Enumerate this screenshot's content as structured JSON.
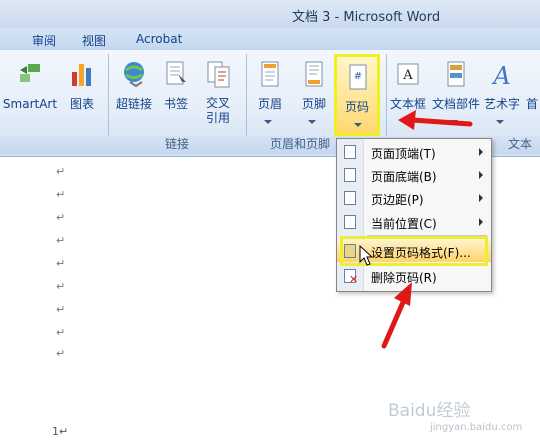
{
  "window": {
    "title": "文档 3 - Microsoft Word"
  },
  "tabs": [
    "审阅",
    "视图",
    "Acrobat"
  ],
  "ribbon": {
    "buttons": [
      {
        "label": "SmartArt"
      },
      {
        "label": "图表"
      },
      {
        "label": "超链接"
      },
      {
        "label": "书签"
      },
      {
        "label": "交叉\n引用"
      },
      {
        "label": "页眉"
      },
      {
        "label": "页脚"
      },
      {
        "label": "页码"
      },
      {
        "label": "文本框"
      },
      {
        "label": "文档部件"
      },
      {
        "label": "艺术字"
      },
      {
        "label": "首"
      }
    ],
    "groups": [
      "链接",
      "页眉和页脚",
      "文本"
    ]
  },
  "menu": {
    "items": [
      {
        "label": "页面顶端(T)",
        "has_submenu": true
      },
      {
        "label": "页面底端(B)",
        "has_submenu": true
      },
      {
        "label": "页边距(P)",
        "has_submenu": true
      },
      {
        "label": "当前位置(C)",
        "has_submenu": true
      },
      {
        "label": "设置页码格式(F)...",
        "has_submenu": false,
        "active": true
      },
      {
        "label": "删除页码(R)",
        "has_submenu": false
      }
    ]
  },
  "doc": {
    "paragraph_mark": "↵",
    "page_number_line": "1↵"
  },
  "watermark": {
    "text": "Baidu经验",
    "url": "jingyan.baidu.com"
  },
  "colors": {
    "arrow": "#e01818",
    "highlight": "#eeee30"
  }
}
